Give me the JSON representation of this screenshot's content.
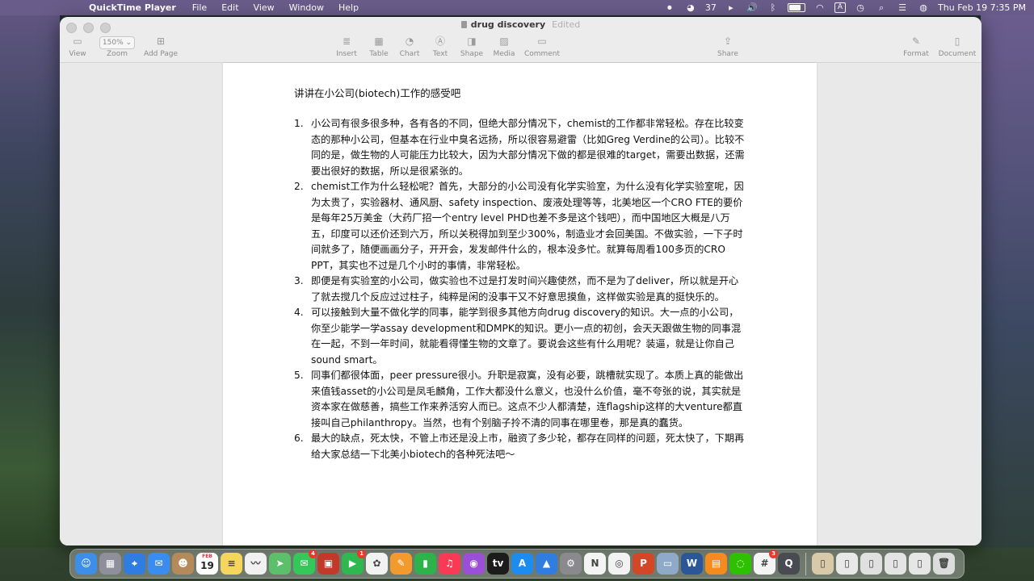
{
  "menubar": {
    "app_name": "QuickTime Player",
    "items": [
      "File",
      "Edit",
      "View",
      "Window",
      "Help"
    ],
    "status": {
      "wechat_count": "37",
      "input_source": "A",
      "datetime": "Thu Feb 19  7:35 PM"
    }
  },
  "window": {
    "title": "drug discovery",
    "edited_label": "Edited",
    "toolbar": {
      "view": "View",
      "zoom_value": "150%",
      "zoom": "Zoom",
      "add_page": "Add Page",
      "insert": "Insert",
      "table": "Table",
      "chart": "Chart",
      "text": "Text",
      "shape": "Shape",
      "media": "Media",
      "comment": "Comment",
      "share": "Share",
      "format": "Format",
      "document": "Document"
    }
  },
  "document": {
    "heading": "讲讲在小公司(biotech)工作的感受吧",
    "items": [
      {
        "num": "1.",
        "text": "小公司有很多很多种，各有各的不同，但绝大部分情况下，chemist的工作都非常轻松。存在比较变态的那种小公司，但基本在行业中臭名远扬，所以很容易避雷（比如Greg Verdine的公司）。比较不同的是，做生物的人可能压力比较大，因为大部分情况下做的都是很难的target，需要出数据，还需要出很好的数据，所以是很紧张的。"
      },
      {
        "num": "2.",
        "text": "chemist工作为什么轻松呢？首先，大部分的小公司没有化学实验室，为什么没有化学实验室呢，因为太贵了，实验器材、通风厨、safety inspection、废液处理等等，北美地区一个CRO FTE的要价是每年25万美金（大药厂招一个entry level PHD也差不多是这个钱吧），而中国地区大概是八万五，印度可以还价还到六万，所以关税得加到至少300%，制造业才会回美国。不做实验，一下子时间就多了，随便画画分子，开开会，发发邮件什么的，根本没多忙。就算每周看100多页的CRO PPT，其实也不过是几个小时的事情，非常轻松。"
      },
      {
        "num": "3.",
        "text": "即便是有实验室的小公司，做实验也不过是打发时间兴趣使然，而不是为了deliver，所以就是开心了就去搅几个反应过过柱子，纯粹是闲的没事干又不好意思摸鱼，这样做实验是真的挺快乐的。"
      },
      {
        "num": "4.",
        "text": "可以接触到大量不做化学的同事，能学到很多其他方向drug discovery的知识。大一点的小公司，你至少能学一学assay development和DMPK的知识。更小一点的初创，会天天跟做生物的同事混在一起，不到一年时间，就能看得懂生物的文章了。要说会这些有什么用呢？装逼，就是让你自己sound smart。"
      },
      {
        "num": "5.",
        "text": "同事们都很体面，peer pressure很小。升职是寂寞，没有必要，跳槽就实现了。本质上真的能做出来值钱asset的小公司是凤毛麟角，工作大都没什么意义，也没什么价值，毫不夸张的说，其实就是资本家在做慈善，搞些工作来养活穷人而已。这点不少人都清楚，连flagship这样的大venture都直接叫自己philanthropy。当然，也有个别脑子拎不清的同事在哪里卷，那是真的蠢货。"
      },
      {
        "num": "6.",
        "text": "最大的缺点，死太快，不管上市还是没上市，融资了多少轮，都存在同样的问题，死太快了，下期再给大家总结一下北美小biotech的各种死法吧～"
      }
    ]
  },
  "dock": {
    "apps": [
      {
        "name": "finder",
        "glyph": "☺",
        "color": "#3d8ee8"
      },
      {
        "name": "launchpad",
        "glyph": "▦",
        "color": "#8f8f9c"
      },
      {
        "name": "safari",
        "glyph": "⌖",
        "color": "#2f7de1"
      },
      {
        "name": "mail",
        "glyph": "✉",
        "color": "#3a8df0"
      },
      {
        "name": "contacts",
        "glyph": "☻",
        "color": "#b48a5a"
      },
      {
        "name": "calendar",
        "glyph": "19",
        "color": "#ffffff",
        "label_top": "FEB"
      },
      {
        "name": "notes",
        "glyph": "≡",
        "color": "#f6d55c"
      },
      {
        "name": "freeform",
        "glyph": "〰",
        "color": "#f1f1f1"
      },
      {
        "name": "maps",
        "glyph": "➤",
        "color": "#5cbf6a"
      },
      {
        "name": "messages",
        "glyph": "✉",
        "color": "#34c759",
        "badge": "4"
      },
      {
        "name": "photo-booth",
        "glyph": "▣",
        "color": "#c0392b"
      },
      {
        "name": "facetime",
        "glyph": "▶",
        "color": "#2fb84f",
        "badge": "1"
      },
      {
        "name": "photos",
        "glyph": "✿",
        "color": "#f2f2f2"
      },
      {
        "name": "pages",
        "glyph": "✎",
        "color": "#f29a2e"
      },
      {
        "name": "numbers",
        "glyph": "▮",
        "color": "#2eb34a"
      },
      {
        "name": "music",
        "glyph": "♫",
        "color": "#fa3a55"
      },
      {
        "name": "podcasts",
        "glyph": "◉",
        "color": "#9b4fd9"
      },
      {
        "name": "apple-tv",
        "glyph": "tv",
        "color": "#1c1c1c"
      },
      {
        "name": "app-store",
        "glyph": "A",
        "color": "#1d8cf0"
      },
      {
        "name": "keynote",
        "glyph": "▲",
        "color": "#2f7de1"
      },
      {
        "name": "system-settings",
        "glyph": "⚙",
        "color": "#8a8a8e"
      },
      {
        "name": "news",
        "glyph": "N",
        "color": "#f4f4f4"
      },
      {
        "name": "chrome",
        "glyph": "◎",
        "color": "#f2f2f2"
      },
      {
        "name": "powerpoint",
        "glyph": "P",
        "color": "#d24726"
      },
      {
        "name": "preview",
        "glyph": "▭",
        "color": "#8fa9c9"
      },
      {
        "name": "word",
        "glyph": "W",
        "color": "#2b579a"
      },
      {
        "name": "books",
        "glyph": "▤",
        "color": "#f58a1f"
      },
      {
        "name": "wechat",
        "glyph": "◌",
        "color": "#2dc100"
      },
      {
        "name": "slack",
        "glyph": "#",
        "color": "#f4f4f4",
        "badge": "3"
      },
      {
        "name": "quicktime",
        "glyph": "Q",
        "color": "#4a4a52"
      },
      {
        "name": "doc-stack-1",
        "glyph": "▯",
        "color": "#d8c9a8"
      },
      {
        "name": "doc-stack-2",
        "glyph": "▯",
        "color": "#e8e8e8"
      },
      {
        "name": "doc-stack-3",
        "glyph": "▯",
        "color": "#e0e0e0"
      },
      {
        "name": "doc-stack-4",
        "glyph": "▯",
        "color": "#e4e4e4"
      },
      {
        "name": "doc-stack-5",
        "glyph": "▯",
        "color": "#e6e6e6"
      },
      {
        "name": "trash",
        "glyph": "🗑",
        "color": "#dcdcdc"
      }
    ]
  }
}
